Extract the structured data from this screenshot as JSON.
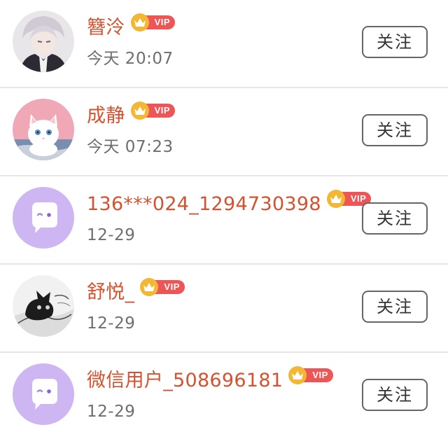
{
  "users": [
    {
      "name": "簪泠",
      "time": "今天 20:07",
      "badge": "VIP",
      "follow_label": "关注",
      "avatar": "anime-boy-avatar"
    },
    {
      "name": "成静",
      "time": "今天 07:23",
      "badge": "VIP",
      "follow_label": "关注",
      "avatar": "white-cat-avatar"
    },
    {
      "name": "136***024_1294730398",
      "time": "12-29",
      "badge": "VIP",
      "follow_label": "关注",
      "avatar": "default-chat-avatar"
    },
    {
      "name": "舒悦_",
      "time": "12-29",
      "badge": "VIP",
      "follow_label": "关注",
      "avatar": "black-cat-sketch-avatar"
    },
    {
      "name": "微信用户_508696181",
      "time": "12-29",
      "badge": "VIP",
      "follow_label": "关注",
      "avatar": "default-chat-avatar"
    }
  ],
  "colors": {
    "name": "#d4522f",
    "time": "#6e6e6e",
    "vip_badge": "#ec5656",
    "crown": "#f3b733",
    "default_avatar_bg": "#cdb6f2"
  }
}
